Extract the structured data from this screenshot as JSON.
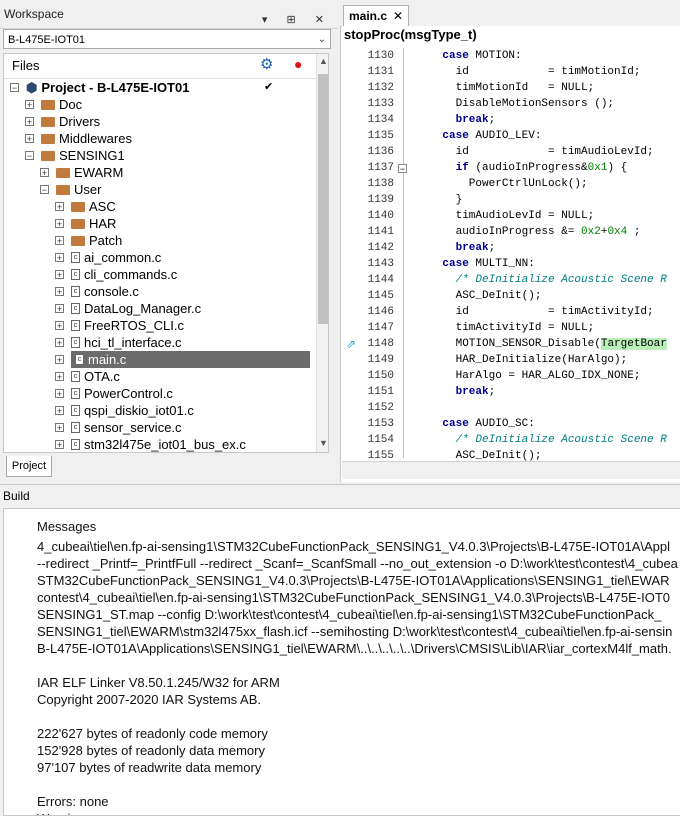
{
  "workspace": {
    "title": "Workspace",
    "title_buttons": "▾ ⊞ ✕",
    "config": "B-L475E-IOT01",
    "files_header": "Files",
    "bottom_tab": "Project",
    "tree": [
      {
        "label": "Project - B-L475E-IOT01",
        "type": "project",
        "expanded": true,
        "check": "✔"
      },
      {
        "label": "Doc",
        "type": "folder",
        "expanded": false
      },
      {
        "label": "Drivers",
        "type": "folder",
        "expanded": false
      },
      {
        "label": "Middlewares",
        "type": "folder",
        "expanded": false
      },
      {
        "label": "SENSING1",
        "type": "folder",
        "expanded": true
      },
      {
        "label": "EWARM",
        "type": "folder",
        "expanded": false
      },
      {
        "label": "User",
        "type": "folder",
        "expanded": true
      },
      {
        "label": "ASC",
        "type": "folder",
        "expanded": false
      },
      {
        "label": "HAR",
        "type": "folder",
        "expanded": false
      },
      {
        "label": "Patch",
        "type": "folder",
        "expanded": false
      },
      {
        "label": "ai_common.c",
        "type": "file"
      },
      {
        "label": "cli_commands.c",
        "type": "file"
      },
      {
        "label": "console.c",
        "type": "file"
      },
      {
        "label": "DataLog_Manager.c",
        "type": "file"
      },
      {
        "label": "FreeRTOS_CLI.c",
        "type": "file"
      },
      {
        "label": "hci_tl_interface.c",
        "type": "file"
      },
      {
        "label": "main.c",
        "type": "file",
        "selected": true
      },
      {
        "label": "OTA.c",
        "type": "file"
      },
      {
        "label": "PowerControl.c",
        "type": "file"
      },
      {
        "label": "qspi_diskio_iot01.c",
        "type": "file"
      },
      {
        "label": "sensor_service.c",
        "type": "file"
      },
      {
        "label": "stm32l475e_iot01_bus_ex.c",
        "type": "file"
      }
    ]
  },
  "editor": {
    "tab_label": "main.c",
    "tab_close": "✕",
    "function": "stopProc(msgType_t)",
    "lines": [
      {
        "n": "1130",
        "t": "    case MOTION:"
      },
      {
        "n": "1131",
        "t": "      id            = timMotionId;"
      },
      {
        "n": "1132",
        "t": "      timMotionId   = NULL;"
      },
      {
        "n": "1133",
        "t": "      DisableMotionSensors ();"
      },
      {
        "n": "1134",
        "t": "      break;"
      },
      {
        "n": "1135",
        "t": "    case AUDIO_LEV:"
      },
      {
        "n": "1136",
        "t": "      id            = timAudioLevId;"
      },
      {
        "n": "1137",
        "t": "      if (audioInProgress&0x1) {"
      },
      {
        "n": "1138",
        "t": "        PowerCtrlUnLock();"
      },
      {
        "n": "1139",
        "t": "      }"
      },
      {
        "n": "1140",
        "t": "      timAudioLevId = NULL;"
      },
      {
        "n": "1141",
        "t": "      audioInProgress &= 0x2+0x4 ;"
      },
      {
        "n": "1142",
        "t": "      break;"
      },
      {
        "n": "1143",
        "t": "    case MULTI_NN:"
      },
      {
        "n": "1144",
        "t": "      /* DeInitialize Acoustic Scene R"
      },
      {
        "n": "1145",
        "t": "      ASC_DeInit();"
      },
      {
        "n": "1146",
        "t": "      id            = timActivityId;"
      },
      {
        "n": "1147",
        "t": "      timActivityId = NULL;"
      },
      {
        "n": "1148",
        "t": "      MOTION_SENSOR_Disable(TargetBoar"
      },
      {
        "n": "1149",
        "t": "      HAR_DeInitialize(HarAlgo);"
      },
      {
        "n": "1150",
        "t": "      HarAlgo = HAR_ALGO_IDX_NONE;"
      },
      {
        "n": "1151",
        "t": "      break;"
      },
      {
        "n": "1152",
        "t": ""
      },
      {
        "n": "1153",
        "t": "    case AUDIO_SC:"
      },
      {
        "n": "1154",
        "t": "      /* DeInitialize Acoustic Scene R"
      },
      {
        "n": "1155",
        "t": "      ASC_DeInit();"
      }
    ]
  },
  "build": {
    "title": "Build",
    "header": "Messages",
    "lines": [
      "4_cubeai\\tiel\\en.fp-ai-sensing1\\STM32CubeFunctionPack_SENSING1_V4.0.3\\Projects\\B-L475E-IOT01A\\Appl",
      "--redirect _Printf=_PrintfFull --redirect _Scanf=_ScanfSmall --no_out_extension -o D:\\work\\test\\contest\\4_cubea",
      "STM32CubeFunctionPack_SENSING1_V4.0.3\\Projects\\B-L475E-IOT01A\\Applications\\SENSING1_tiel\\EWAR",
      "contest\\4_cubeai\\tiel\\en.fp-ai-sensing1\\STM32CubeFunctionPack_SENSING1_V4.0.3\\Projects\\B-L475E-IOT0",
      "SENSING1_ST.map --config D:\\work\\test\\contest\\4_cubeai\\tiel\\en.fp-ai-sensing1\\STM32CubeFunctionPack_",
      "SENSING1_tiel\\EWARM\\stm32l475xx_flash.icf --semihosting D:\\work\\test\\contest\\4_cubeai\\tiel\\en.fp-ai-sensin",
      "B-L475E-IOT01A\\Applications\\SENSING1_tiel\\EWARM\\..\\..\\..\\..\\..\\Drivers\\CMSIS\\Lib\\IAR\\iar_cortexM4lf_math.",
      "",
      "   IAR ELF Linker V8.50.1.245/W32 for ARM",
      "   Copyright 2007-2020 IAR Systems AB.",
      "",
      "  222'627 bytes of readonly  code memory",
      "  152'928 bytes of readonly  data memory",
      "   97'107 bytes of readwrite data memory",
      "",
      "Errors: none",
      "Warnings: none"
    ]
  }
}
